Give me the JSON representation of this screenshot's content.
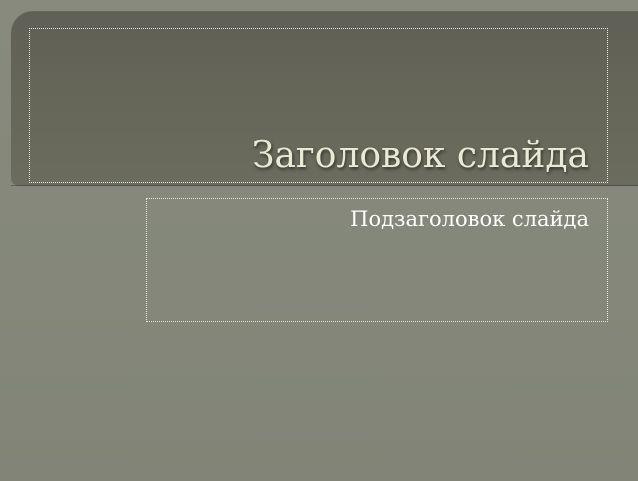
{
  "slide": {
    "title": "Заголовок слайда",
    "subtitle": "Подзаголовок слайда"
  },
  "colors": {
    "background": "#84877a",
    "title_band": "#666659",
    "title_text": "#e9e9d4",
    "subtitle_text": "#ffffff",
    "placeholder_border": "#e6e6dc"
  }
}
